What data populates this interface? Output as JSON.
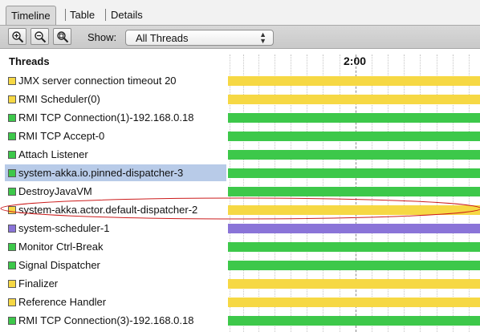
{
  "tabs": [
    {
      "label": "Timeline",
      "active": true
    },
    {
      "label": "Table",
      "active": false
    },
    {
      "label": "Details",
      "active": false
    }
  ],
  "toolbar": {
    "zoom_buttons": [
      "zoom-in-icon",
      "zoom-out-icon",
      "zoom-fit-icon"
    ],
    "show_label": "Show:",
    "show_select_value": "All Threads"
  },
  "timeline": {
    "column_header": "Threads",
    "time_marker": "2:00"
  },
  "colors": {
    "running": "#3dc84a",
    "waiting": "#f6d844",
    "sleeping": "#8a74d8",
    "selected_row": "#b8cbe8",
    "annotation": "#cc1c1c"
  },
  "threads": [
    {
      "name": "JMX server connection timeout 20",
      "state": "waiting"
    },
    {
      "name": "RMI Scheduler(0)",
      "state": "waiting"
    },
    {
      "name": "RMI TCP Connection(1)-192.168.0.18",
      "state": "running"
    },
    {
      "name": "RMI TCP Accept-0",
      "state": "running"
    },
    {
      "name": "Attach Listener",
      "state": "running"
    },
    {
      "name": "system-akka.io.pinned-dispatcher-3",
      "state": "running",
      "selected": true
    },
    {
      "name": "DestroyJavaVM",
      "state": "running"
    },
    {
      "name": "system-akka.actor.default-dispatcher-2",
      "state": "waiting",
      "highlighted": true
    },
    {
      "name": "system-scheduler-1",
      "state": "sleeping"
    },
    {
      "name": "Monitor Ctrl-Break",
      "state": "running"
    },
    {
      "name": "Signal Dispatcher",
      "state": "running"
    },
    {
      "name": "Finalizer",
      "state": "waiting"
    },
    {
      "name": "Reference Handler",
      "state": "waiting"
    },
    {
      "name": "RMI TCP Connection(3)-192.168.0.18",
      "state": "running"
    }
  ]
}
